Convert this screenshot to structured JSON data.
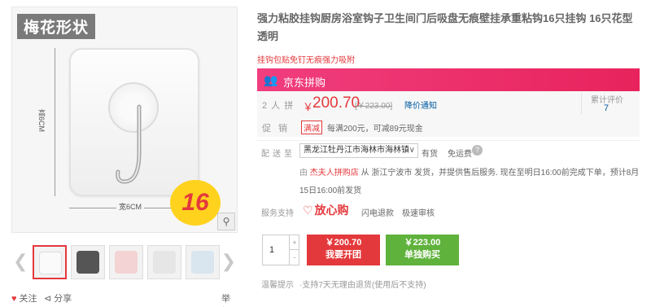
{
  "gallery": {
    "shape_label": "梅花形状",
    "dim_vertical": "高6CM",
    "dim_horizontal": "宽6CM",
    "badge": "16",
    "zoom_icon": "magnifier-icon",
    "thumb_count": 5
  },
  "actions": {
    "follow": "关注",
    "share": "分享",
    "report": "举报"
  },
  "product": {
    "title": "强力粘胶挂钩厨房浴室钩子卫生间门后吸盘无痕壁挂承重粘钩16只挂钩 16只花型透明",
    "promo_note": "挂钩包贴免钉无痕强力吸附"
  },
  "group_buy": {
    "label": "京东拼购",
    "people_label": "2 人 拼",
    "currency": "￥",
    "price": "200.70",
    "old_price": "[￥223.00]",
    "notify": "降价通知",
    "review_label": "累计评价",
    "review_count": "7",
    "promo_label": "促  销",
    "promo_tag": "满减",
    "promo_text": "每满200元，可减89元现金"
  },
  "shipping": {
    "label": "配送至",
    "address": "黑龙江牡丹江市海林市海林镇",
    "stock": "有货",
    "fee": "免运费",
    "from_label": "由",
    "shop": "杰夫人拼购店",
    "store_text": "从 浙江宁波市 发货，并提供售后服务. 现在至明日16:00前完成下单，预计8月15日16:00前发货"
  },
  "service": {
    "label": "服务支持",
    "main": "放心购",
    "items": [
      "闪电退款",
      "极速审核"
    ]
  },
  "purchase": {
    "quantity": "1",
    "plus": "+",
    "minus": "-",
    "group_price": "￥200.70",
    "group_action": "我要开团",
    "solo_price": "￥223.00",
    "solo_action": "单独购买"
  },
  "tips": {
    "label": "温馨提示",
    "text": "·支持7天无理由退货(使用后不支持)"
  },
  "colors": {
    "accent": "#e4393c",
    "group_bar": "#e8235c",
    "solo_button": "#5fb23c",
    "link": "#005aa0"
  }
}
